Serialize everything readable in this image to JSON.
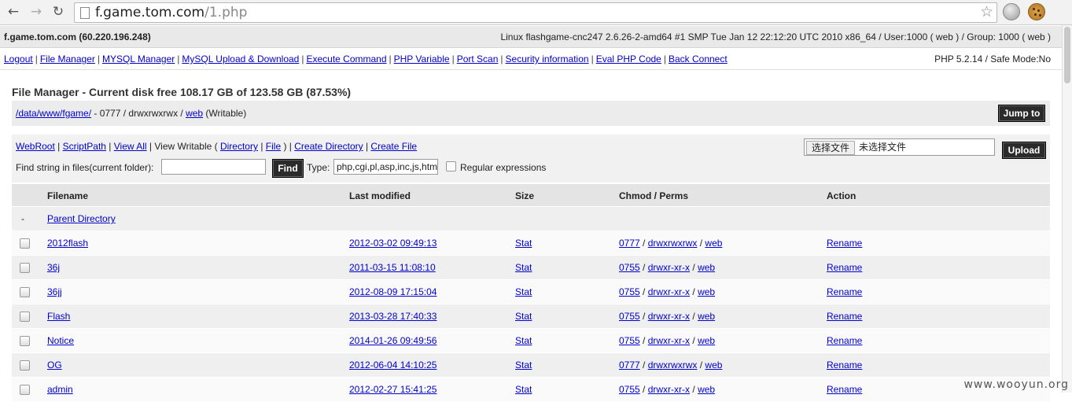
{
  "browser": {
    "url_host": "f.game.tom.com",
    "url_path": "/1.php"
  },
  "server_info": {
    "host": "f.game.tom.com (60.220.196.248)",
    "system": "Linux flashgame-cnc247 2.6.26-2-amd64 #1 SMP Tue Jan 12 22:12:20 UTC 2010 x86_64 / User:1000 ( web ) / Group: 1000 ( web )"
  },
  "menu": {
    "items": [
      "Logout",
      "File Manager",
      "MYSQL Manager",
      "MySQL Upload & Download",
      "Execute Command",
      "PHP Variable",
      "Port Scan",
      "Security information",
      "Eval PHP Code",
      "Back Connect"
    ],
    "php_info": "PHP 5.2.14 / Safe Mode:No"
  },
  "file_manager": {
    "title": "File Manager - Current disk free 108.17 GB of 123.58 GB (87.53%)",
    "path": "/data/www/fgame/",
    "path_perm": " - 0777 / drwxrwxrwx / ",
    "path_owner": "web",
    "path_status": " (Writable)",
    "jump_label": "Jump to"
  },
  "tools": {
    "links": [
      "WebRoot",
      "ScriptPath",
      "View All"
    ],
    "view_writable": "View Writable (",
    "vw_links": [
      "Directory",
      "File"
    ],
    "create_links": [
      "Create Directory",
      "Create File"
    ],
    "find_label": "Find string in files(current folder):",
    "find_button": "Find",
    "type_label": "Type:",
    "type_value": "php,cgi,pl,asp,inc,js,htm",
    "regex_label": "Regular expressions",
    "choose_file": "选择文件",
    "no_file": "未选择文件",
    "upload_label": "Upload"
  },
  "table": {
    "headers": {
      "filename": "Filename",
      "modified": "Last modified",
      "size": "Size",
      "chmod": "Chmod / Perms",
      "action": "Action"
    },
    "parent": {
      "marker": "-",
      "label": "Parent Directory"
    },
    "rows": [
      {
        "name": "2012flash",
        "modified": "2012-03-02 09:49:13",
        "size": "Stat",
        "octal": "0777",
        "perms": "drwxrwxrwx",
        "owner": "web",
        "action": "Rename"
      },
      {
        "name": "36j",
        "modified": "2011-03-15 11:08:10",
        "size": "Stat",
        "octal": "0755",
        "perms": "drwxr-xr-x",
        "owner": "web",
        "action": "Rename"
      },
      {
        "name": "36jj",
        "modified": "2012-08-09 17:15:04",
        "size": "Stat",
        "octal": "0755",
        "perms": "drwxr-xr-x",
        "owner": "web",
        "action": "Rename"
      },
      {
        "name": "Flash",
        "modified": "2013-03-28 17:40:33",
        "size": "Stat",
        "octal": "0755",
        "perms": "drwxr-xr-x",
        "owner": "web",
        "action": "Rename"
      },
      {
        "name": "Notice",
        "modified": "2014-01-26 09:49:56",
        "size": "Stat",
        "octal": "0755",
        "perms": "drwxr-xr-x",
        "owner": "web",
        "action": "Rename"
      },
      {
        "name": "OG",
        "modified": "2012-06-04 14:10:25",
        "size": "Stat",
        "octal": "0777",
        "perms": "drwxrwxrwx",
        "owner": "web",
        "action": "Rename"
      },
      {
        "name": "admin",
        "modified": "2012-02-27 15:41:25",
        "size": "Stat",
        "octal": "0755",
        "perms": "drwxr-xr-x",
        "owner": "web",
        "action": "Rename"
      }
    ]
  },
  "watermark": "www.wooyun.org"
}
